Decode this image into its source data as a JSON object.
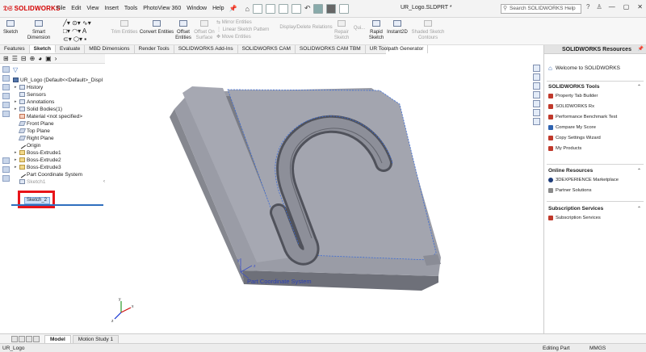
{
  "app": {
    "brand": "SOLIDWORKS",
    "menus": [
      "File",
      "Edit",
      "View",
      "Insert",
      "Tools",
      "PhotoView 360",
      "Window",
      "Help"
    ],
    "document_title": "UR_Logo.SLDPRT *",
    "search_placeholder": "Search SOLIDWORKS Help"
  },
  "command_manager": {
    "sketch": "Sketch",
    "smart_dimension": "Smart Dimension",
    "trim_entities": "Trim Entities",
    "convert_entities": "Convert Entities",
    "offset_entities_1": "Offset",
    "offset_entities_2": "Entities",
    "offset_on_surface_1": "Offset On",
    "offset_on_surface_2": "Surface",
    "mirror_entities": "Mirror Entities",
    "linear_sketch_pattern": "Linear Sketch Pattern",
    "move_entities": "Move Entities",
    "display_delete_relations": "Display/Delete Relations",
    "repair_sketch_1": "Repair",
    "repair_sketch_2": "Sketch",
    "quick_snaps": "Qui...",
    "rapid_sketch_1": "Rapid",
    "rapid_sketch_2": "Sketch",
    "instant2d": "Instant2D",
    "shaded_sketch_1": "Shaded Sketch",
    "shaded_sketch_2": "Contours"
  },
  "tabs": [
    "Features",
    "Sketch",
    "Evaluate",
    "MBD Dimensions",
    "Render Tools",
    "SOLIDWORKS Add-Ins",
    "SOLIDWORKS CAM",
    "SOLIDWORKS CAM TBM",
    "UR Toolpath Generator"
  ],
  "active_tab": "Sketch",
  "feature_tree": {
    "root": "UR_Logo  (Default<<Default>_Displ",
    "items": [
      {
        "label": "History",
        "arrow": "▸"
      },
      {
        "label": "Sensors",
        "arrow": ""
      },
      {
        "label": "Annotations",
        "arrow": "▸"
      },
      {
        "label": "Solid Bodies(1)",
        "arrow": "▸"
      },
      {
        "label": "Material <not specified>",
        "arrow": ""
      },
      {
        "label": "Front Plane",
        "arrow": ""
      },
      {
        "label": "Top Plane",
        "arrow": ""
      },
      {
        "label": "Right Plane",
        "arrow": ""
      },
      {
        "label": "Origin",
        "arrow": ""
      },
      {
        "label": "Boss-Extrude1",
        "arrow": "▸"
      },
      {
        "label": "Boss-Extrude2",
        "arrow": "▸"
      },
      {
        "label": "Boss-Extrude3",
        "arrow": "▸"
      },
      {
        "label": "Part Coordinate System",
        "arrow": ""
      },
      {
        "label": "Sketch1",
        "arrow": ""
      }
    ],
    "selected": "Sketch_2"
  },
  "viewport": {
    "coordinate_system_label": "Part Coordinate System",
    "axis_x": "x",
    "axis_y": "y",
    "axis_z": "z"
  },
  "task_pane": {
    "title": "SOLIDWORKS Resources",
    "welcome": "Welcome to SOLIDWORKS",
    "tools_header": "SOLIDWORKS Tools",
    "tools": [
      "Property Tab Builder",
      "SOLIDWORKS Rx",
      "Performance Benchmark Test",
      "Compare My Score",
      "Copy Settings Wizard",
      "My Products"
    ],
    "online_header": "Online Resources",
    "online": [
      "3DEXPERIENCE Marketplace",
      "Partner Solutions"
    ],
    "subscription_header": "Subscription Services",
    "subscription": [
      "Subscription Services"
    ]
  },
  "bottom_tabs": [
    "Model",
    "Motion Study 1"
  ],
  "status": {
    "left": "UR_Logo",
    "mode": "Editing Part",
    "units": "MMGS"
  },
  "colors": {
    "highlight_red": "#e8141a",
    "selection_blue": "#2f6fbf",
    "part_gray": "#9a9ca6"
  }
}
